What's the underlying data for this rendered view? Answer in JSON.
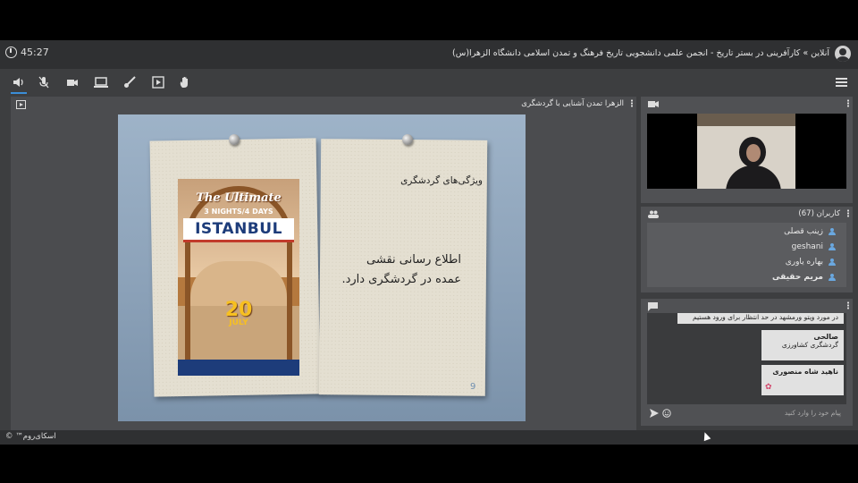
{
  "header": {
    "timer": "45:27",
    "title": "آنلاین » کارآفرینی در بستر تاریخ - انجمن علمی دانشجویی تاریخ فرهنگ و تمدن اسلامی دانشگاه الزهرا(س)"
  },
  "toolbar": {
    "icons": [
      "speaker-icon",
      "mic-muted-icon",
      "camera-icon",
      "screen-share-icon",
      "brush-icon",
      "media-icon",
      "raise-hand-icon",
      "menu-icon"
    ]
  },
  "stage": {
    "title": "الزهرا تمدن آشنایی با گردشگری",
    "slide": {
      "heading": "ویژگی‌های گردشگری",
      "body_line1": "اطلاع رسانی نقشی",
      "body_line2": "عمده در گردشگری دارد.",
      "page_number": "9",
      "poster": {
        "line1": "The Ultimate",
        "line2": "3 NIGHTS/4 DAYS",
        "line3": "ISTANBUL",
        "day": "20",
        "month": "JULY"
      }
    }
  },
  "users": {
    "title": "کاربران (67)",
    "list": [
      "زینب قصلی",
      "geshani",
      "بهاره یاوری",
      "مریم حقیقی"
    ]
  },
  "chat": {
    "partial_message": "در مورد ویتو ورمشهد در حد انتظار برای ورود هستیم",
    "messages": [
      {
        "sender": "صالحی",
        "text": "گردشگری کشاورزی"
      },
      {
        "sender": "ناهید شاه منصوری",
        "text": ""
      }
    ],
    "placeholder": "پیام خود را وارد کنید"
  },
  "footer": {
    "brand": "اسکای‌روم™ ©"
  }
}
